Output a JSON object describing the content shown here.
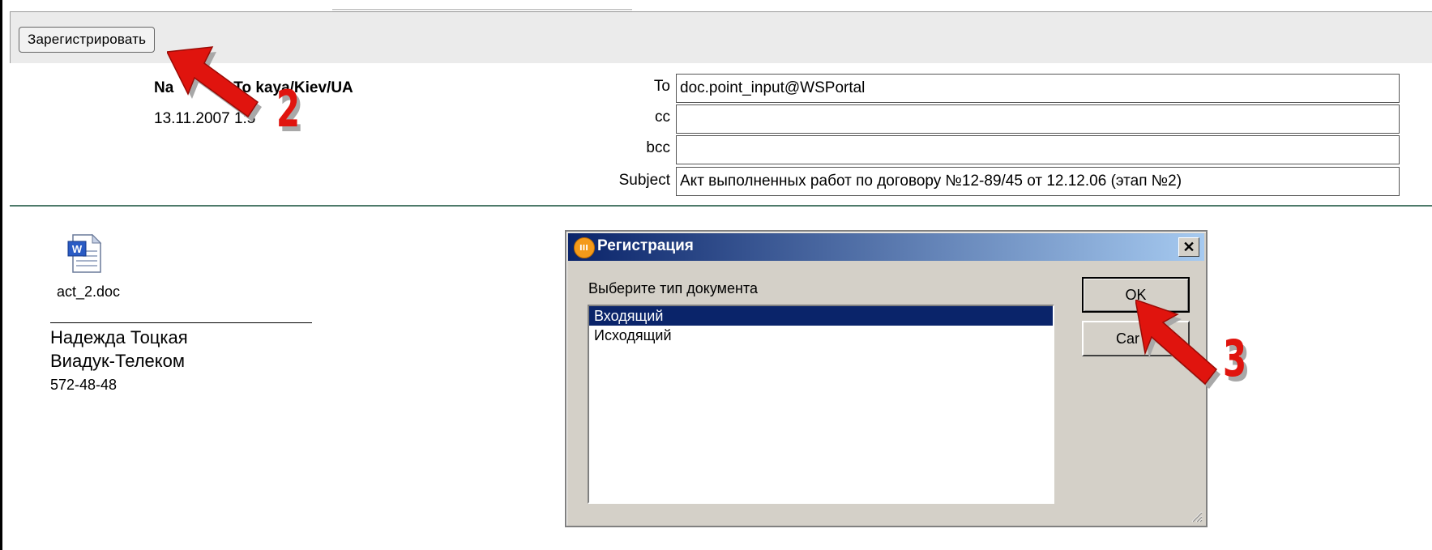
{
  "toolbar": {
    "register_label": "Зарегистрировать"
  },
  "header": {
    "sender_name": "Na",
    "sender_name_tail": "To  kaya/Kiev/UA",
    "sender_date": "13.11.2007  1:5",
    "fields": {
      "to_label": "To",
      "to_value": "doc.point_input@WSPortal",
      "cc_label": "cc",
      "cc_value": "",
      "bcc_label": "bcc",
      "bcc_value": "",
      "subject_label": "Subject",
      "subject_value": "Акт выполненных работ по договору №12-89/45 от 12.12.06 (этап №2)"
    }
  },
  "body": {
    "attachment": {
      "name": "act_2.doc",
      "icon": "word-document-icon"
    },
    "signature": {
      "line1": "Надежда Тоцкая",
      "line2": "Виадук-Телеком",
      "phone": "572-48-48"
    }
  },
  "dialog": {
    "title": "Регистрация",
    "close_glyph": "✕",
    "prompt": "Выберите тип документа",
    "items": [
      {
        "label": "Входящий",
        "selected": true
      },
      {
        "label": "Исходящий",
        "selected": false
      }
    ],
    "ok_label": "OK",
    "cancel_label": "Car"
  },
  "annotations": [
    {
      "number": "2",
      "color": "#e0140e"
    },
    {
      "number": "3",
      "color": "#e0140e"
    }
  ]
}
